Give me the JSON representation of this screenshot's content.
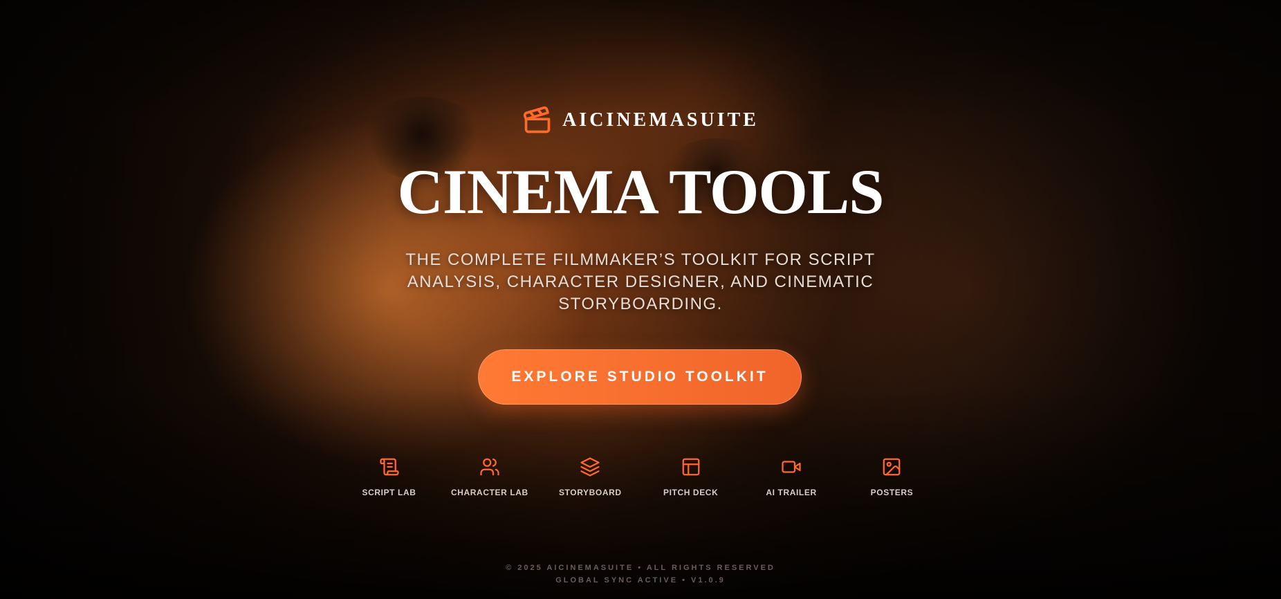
{
  "brand": {
    "name": "AICINEMASUITE",
    "icon": "clapperboard-icon",
    "accent_color": "#ff6a2b"
  },
  "hero": {
    "title": "CINEMA TOOLS",
    "subtitle": "THE COMPLETE FILMMAKER’S TOOLKIT FOR SCRIPT ANALYSIS, CHARACTER DESIGNER, AND CINEMATIC STORYBOARDING.",
    "cta_label": "EXPLORE STUDIO TOOLKIT"
  },
  "tools": [
    {
      "label": "SCRIPT LAB",
      "icon": "scroll-icon"
    },
    {
      "label": "CHARACTER LAB",
      "icon": "users-icon"
    },
    {
      "label": "STORYBOARD",
      "icon": "layers-icon"
    },
    {
      "label": "PITCH DECK",
      "icon": "layout-icon"
    },
    {
      "label": "AI TRAILER",
      "icon": "video-camera-icon"
    },
    {
      "label": "POSTERS",
      "icon": "image-icon"
    }
  ],
  "footer": {
    "copyright": "© 2025 AICINEMASUITE • ALL RIGHTS RESERVED",
    "status": "GLOBAL SYNC ACTIVE • V1.0.9"
  }
}
